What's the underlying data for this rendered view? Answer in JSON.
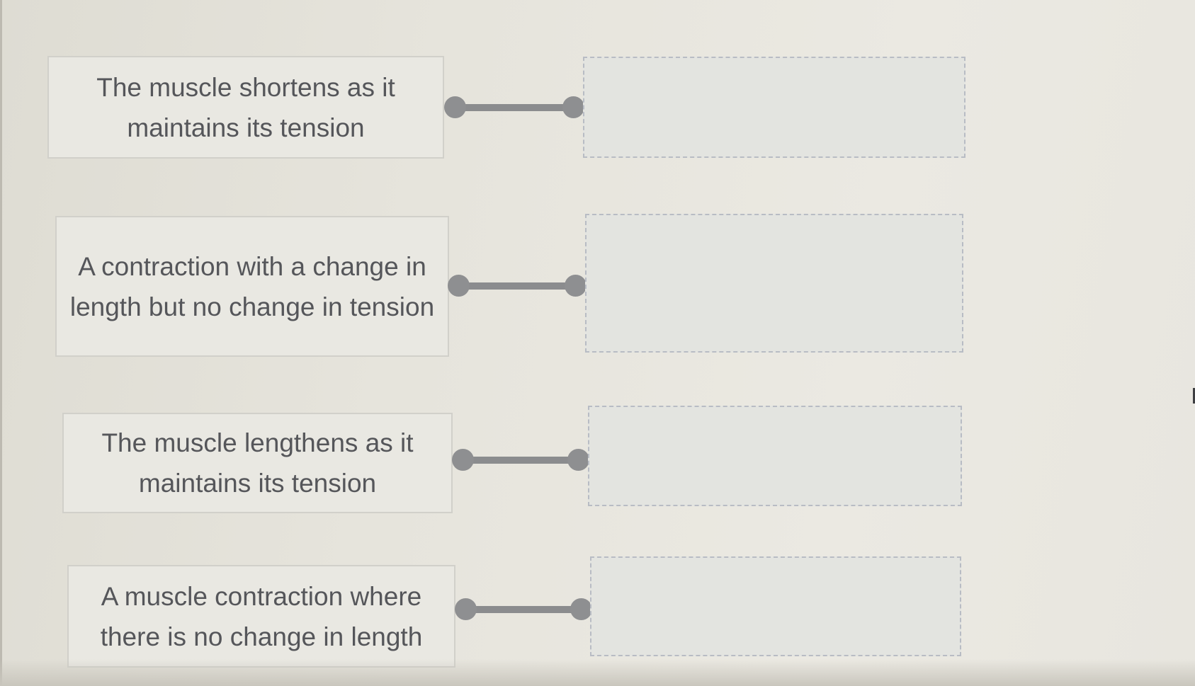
{
  "matching": {
    "rows": [
      {
        "premise": "The muscle shortens as it maintains its tension",
        "answer": ""
      },
      {
        "premise": "A contraction with a change in length but no change in tension",
        "answer": ""
      },
      {
        "premise": "The muscle lengthens as it maintains its tension",
        "answer": ""
      },
      {
        "premise": "A muscle contraction where there is no change in length",
        "answer": ""
      }
    ]
  },
  "colors": {
    "background": "#e6e4dc",
    "premise_box": "#e9e8e2",
    "premise_border": "#d1d0ca",
    "text": "#55565a",
    "connector": "#8b8c8e",
    "drop_zone_border": "#b8bcc4"
  },
  "icons": {
    "connector_handle": "connector-handle-icon"
  }
}
